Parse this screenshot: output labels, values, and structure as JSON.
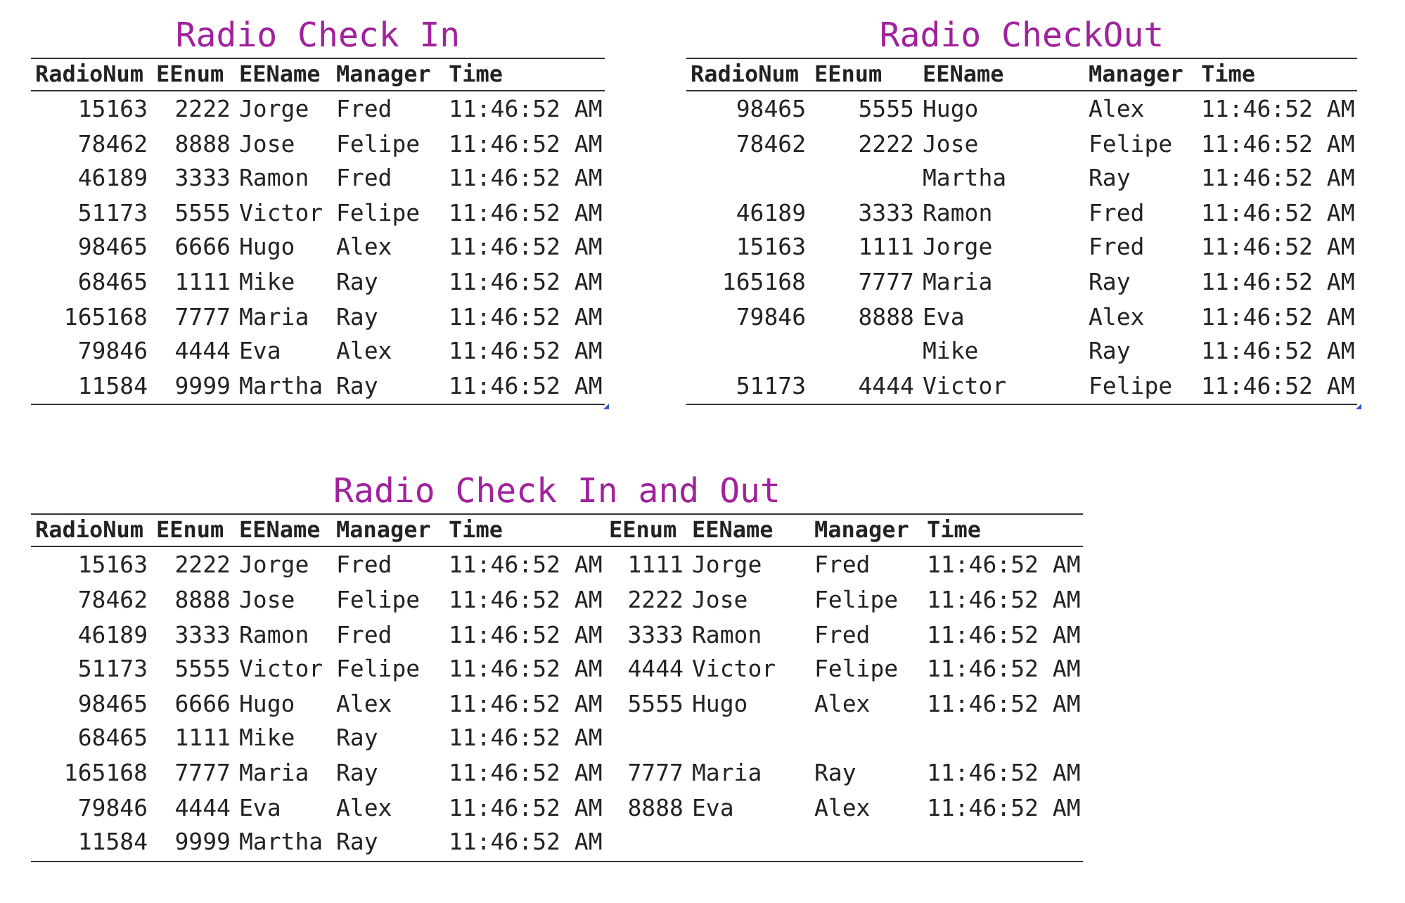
{
  "tables": [
    {
      "title": "Radio Check In",
      "resize_handle": true,
      "columns": [
        "RadioNum",
        "EEnum",
        "EEName",
        "Manager",
        "Time"
      ],
      "rows": [
        [
          "15163",
          "2222",
          "Jorge",
          "Fred",
          "11:46:52 AM"
        ],
        [
          "78462",
          "8888",
          "Jose",
          "Felipe",
          "11:46:52 AM"
        ],
        [
          "46189",
          "3333",
          "Ramon",
          "Fred",
          "11:46:52 AM"
        ],
        [
          "51173",
          "5555",
          "Victor",
          "Felipe",
          "11:46:52 AM"
        ],
        [
          "98465",
          "6666",
          "Hugo",
          "Alex",
          "11:46:52 AM"
        ],
        [
          "68465",
          "1111",
          "Mike",
          "Ray",
          "11:46:52 AM"
        ],
        [
          "165168",
          "7777",
          "Maria",
          "Ray",
          "11:46:52 AM"
        ],
        [
          "79846",
          "4444",
          "Eva",
          "Alex",
          "11:46:52 AM"
        ],
        [
          "11584",
          "9999",
          "Martha",
          "Ray",
          "11:46:52 AM"
        ]
      ]
    },
    {
      "title": "Radio CheckOut",
      "resize_handle": true,
      "columns": [
        "RadioNum",
        "EEnum",
        "EEName",
        "Manager",
        "Time"
      ],
      "rows": [
        [
          "98465",
          "5555",
          "Hugo",
          "Alex",
          "11:46:52 AM"
        ],
        [
          "78462",
          "2222",
          "Jose",
          "Felipe",
          "11:46:52 AM"
        ],
        [
          null,
          null,
          "Martha",
          "Ray",
          "11:46:52 AM"
        ],
        [
          "46189",
          "3333",
          "Ramon",
          "Fred",
          "11:46:52 AM"
        ],
        [
          "15163",
          "1111",
          "Jorge",
          "Fred",
          "11:46:52 AM"
        ],
        [
          "165168",
          "7777",
          "Maria",
          "Ray",
          "11:46:52 AM"
        ],
        [
          "79846",
          "8888",
          "Eva",
          "Alex",
          "11:46:52 AM"
        ],
        [
          null,
          null,
          "Mike",
          "Ray",
          "11:46:52 AM"
        ],
        [
          "51173",
          "4444",
          "Victor",
          "Felipe",
          "11:46:52 AM"
        ]
      ]
    },
    {
      "title": "Radio Check In and Out",
      "resize_handle": false,
      "columns": [
        "RadioNum",
        "EEnum",
        "EEName",
        "Manager",
        "Time",
        "EEnum",
        "EEName",
        "Manager",
        "Time"
      ],
      "rows": [
        [
          "15163",
          "2222",
          "Jorge",
          "Fred",
          "11:46:52 AM",
          "1111",
          "Jorge",
          "Fred",
          "11:46:52 AM"
        ],
        [
          "78462",
          "8888",
          "Jose",
          "Felipe",
          "11:46:52 AM",
          "2222",
          "Jose",
          "Felipe",
          "11:46:52 AM"
        ],
        [
          "46189",
          "3333",
          "Ramon",
          "Fred",
          "11:46:52 AM",
          "3333",
          "Ramon",
          "Fred",
          "11:46:52 AM"
        ],
        [
          "51173",
          "5555",
          "Victor",
          "Felipe",
          "11:46:52 AM",
          "4444",
          "Victor",
          "Felipe",
          "11:46:52 AM"
        ],
        [
          "98465",
          "6666",
          "Hugo",
          "Alex",
          "11:46:52 AM",
          "5555",
          "Hugo",
          "Alex",
          "11:46:52 AM"
        ],
        [
          "68465",
          "1111",
          "Mike",
          "Ray",
          "11:46:52 AM",
          null,
          null,
          null,
          null
        ],
        [
          "165168",
          "7777",
          "Maria",
          "Ray",
          "11:46:52 AM",
          "7777",
          "Maria",
          "Ray",
          "11:46:52 AM"
        ],
        [
          "79846",
          "4444",
          "Eva",
          "Alex",
          "11:46:52 AM",
          "8888",
          "Eva",
          "Alex",
          "11:46:52 AM"
        ],
        [
          "11584",
          "9999",
          "Martha",
          "Ray",
          "11:46:52 AM",
          null,
          null,
          null,
          null
        ]
      ]
    }
  ]
}
